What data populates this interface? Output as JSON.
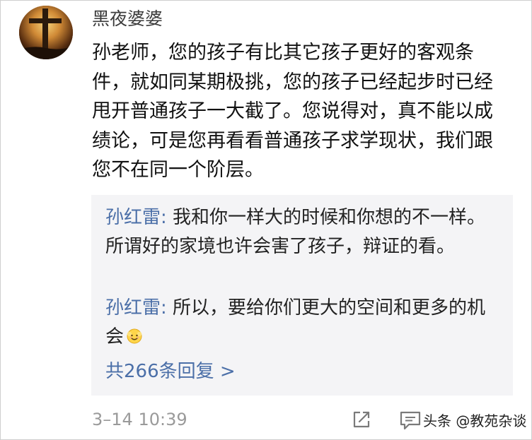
{
  "comment": {
    "username": "黑夜婆婆",
    "text": "孙老师，您的孩子有比其它孩子更好的客观条件，就如同某期极挑，您的孩子已经起步时已经甩开普通孩子一大截了。您说得对，真不能以成绩论，可是您再看看普通孩子求学现状，我们跟您不在同一个阶层。",
    "timestamp": "3–14 10:39"
  },
  "replies": [
    {
      "author": "孙红雷",
      "separator": ": ",
      "text": "我和你一样大的时候和你想的不一样。所谓好的家境也许会害了孩子，辩证的看。"
    },
    {
      "author": "孙红雷",
      "separator": ": ",
      "text": "所以，要给你们更大的空间和更多的机会",
      "emoji": "smiling-face-emoji"
    }
  ],
  "more_replies_label": "共266条回复 >",
  "watermark": "头条 @教苑杂谈",
  "icons": {
    "share": "share-icon",
    "comment": "comment-icon"
  },
  "colors": {
    "link_blue": "#4b6fa8",
    "reply_background": "#f4f4f6",
    "timestamp_gray": "#9a9a9a"
  }
}
